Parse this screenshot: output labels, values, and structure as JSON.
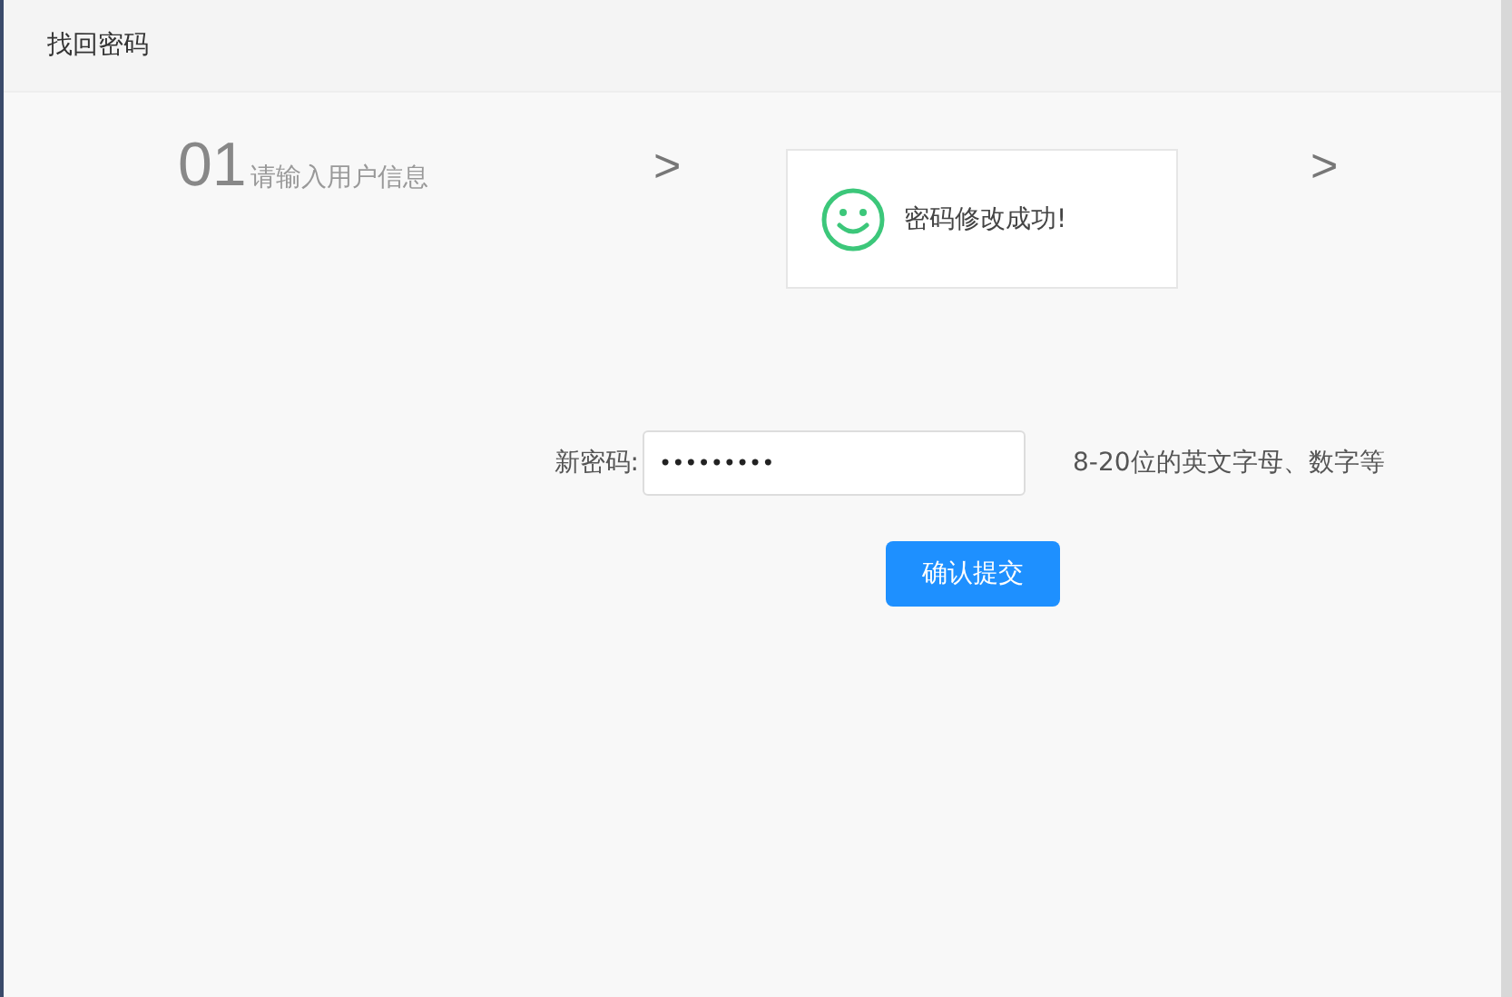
{
  "header": {
    "title": "找回密码"
  },
  "steps": [
    {
      "kind": "step",
      "number": "01",
      "label": "请输入用户信息"
    },
    {
      "kind": "arrow",
      "symbol": ">"
    },
    {
      "kind": "hidden"
    },
    {
      "kind": "arrow",
      "symbol": ">"
    }
  ],
  "toast": {
    "message": "密码修改成功!"
  },
  "form": {
    "label": "新密码:",
    "value": "•••••••••",
    "hint": "8-20位的英文字母、数字等"
  },
  "buttons": [
    "确认提交"
  ]
}
